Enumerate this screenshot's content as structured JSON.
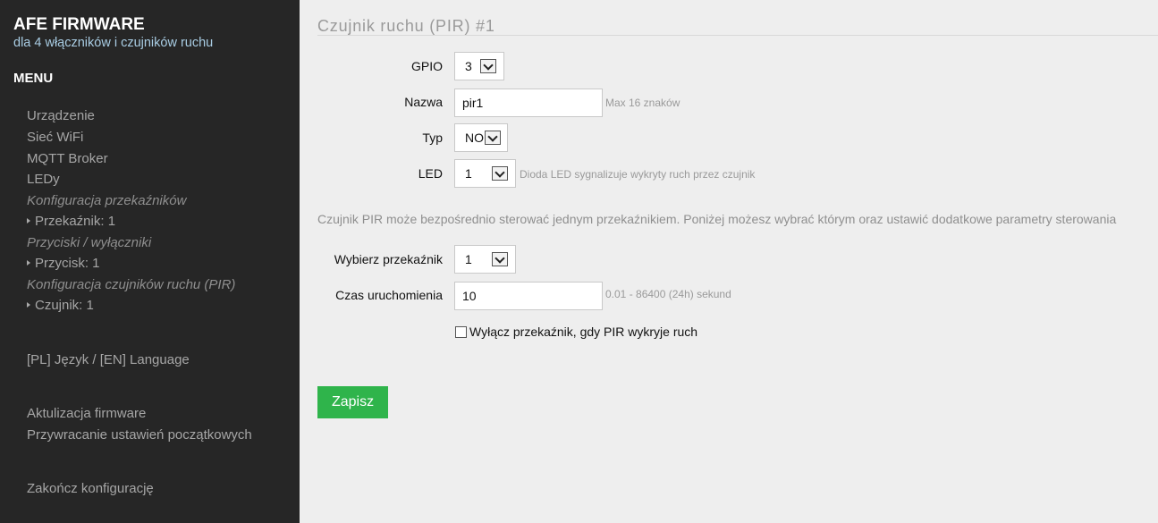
{
  "sidebar": {
    "brand_title": "AFE FIRMWARE",
    "brand_subtitle": "dla 4 włączników i czujników ruchu",
    "menu_title": "MENU",
    "items": [
      {
        "label": "Urządzenie"
      },
      {
        "label": "Sieć WiFi"
      },
      {
        "label": "MQTT Broker"
      },
      {
        "label": "LEDy"
      },
      {
        "label": "Konfiguracja przekaźników"
      },
      {
        "label": "Przekaźnik: 1"
      },
      {
        "label": "Przyciski / wyłączniki"
      },
      {
        "label": "Przycisk: 1"
      },
      {
        "label": "Konfiguracja czujników ruchu (PIR)"
      },
      {
        "label": "Czujnik: 1"
      },
      {
        "label": "[PL] Język / [EN] Language"
      },
      {
        "label": "Aktulizacja firmware"
      },
      {
        "label": "Przywracanie ustawień początkowych"
      },
      {
        "label": "Zakończ konfigurację"
      }
    ]
  },
  "main": {
    "title": "Czujnik ruchu (PIR) #1",
    "form": {
      "gpio_label": "GPIO",
      "gpio_value": "3",
      "name_label": "Nazwa",
      "name_value": "pir1",
      "name_hint": "Max 16 znaków",
      "type_label": "Typ",
      "type_value": "NO",
      "led_label": "LED",
      "led_value": "1",
      "led_hint": "Dioda LED sygnalizuje wykryty ruch przez czujnik",
      "info_text": "Czujnik PIR może bezpośrednio sterować jednym przekaźnikiem. Poniżej możesz wybrać którym oraz ustawić dodatkowe parametry sterowania",
      "relay_label": "Wybierz przekaźnik",
      "relay_value": "1",
      "time_label": "Czas uruchomienia",
      "time_value": "10",
      "time_hint": "0.01 - 86400 (24h) sekund",
      "checkbox_label": "Wyłącz przekaźnik, gdy PIR wykryje ruch",
      "checkbox_checked": false
    },
    "save_label": "Zapisz"
  },
  "colors": {
    "sidebar_bg": "#262626",
    "main_bg": "#eeeeee",
    "accent_green": "#2fb44b",
    "subtitle_blue": "#a9cde4"
  }
}
